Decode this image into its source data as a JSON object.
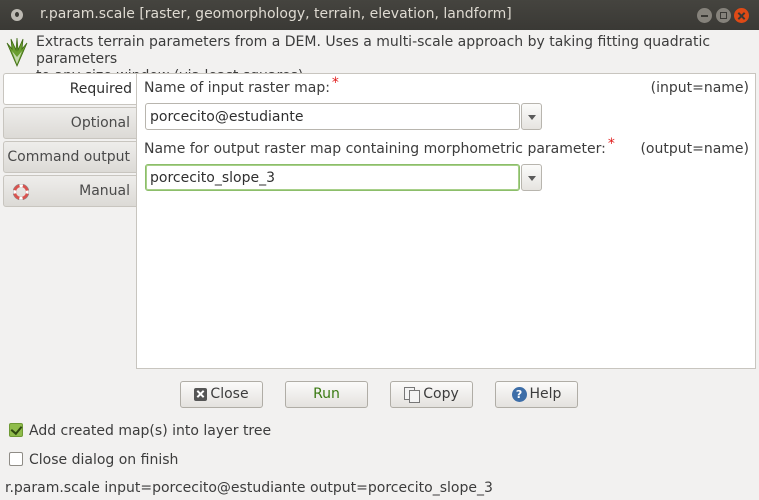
{
  "window": {
    "title": "r.param.scale [raster, geomorphology, terrain, elevation, landform]"
  },
  "description": "Extracts terrain parameters from a DEM. Uses a multi-scale approach by taking fitting quadratic parameters\nto any size window (via least squares).",
  "tabs": [
    {
      "label": "Required",
      "active": true
    },
    {
      "label": "Optional",
      "active": false
    },
    {
      "label": "Command output",
      "active": false
    },
    {
      "label": "Manual",
      "active": false
    }
  ],
  "fields": {
    "input": {
      "label": "Name of input raster map:",
      "required_mark": "*",
      "key": "(input=name)",
      "value": "porcecito@estudiante"
    },
    "output": {
      "label": "Name for output raster map containing morphometric parameter:",
      "required_mark": "*",
      "key": "(output=name)",
      "value": "porcecito_slope_3"
    }
  },
  "buttons": {
    "close": "Close",
    "run": "Run",
    "copy": "Copy",
    "help": "Help"
  },
  "options": {
    "add_to_tree": {
      "label": "Add created map(s) into layer tree",
      "checked": true
    },
    "close_on_finish": {
      "label": "Close dialog on finish",
      "checked": false
    }
  },
  "command_line": "r.param.scale input=porcecito@estudiante output=porcecito_slope_3",
  "colors": {
    "titlebar": "#3a3935",
    "close_button": "#df4a16",
    "run_text": "#3a7a12",
    "required_mark": "#e01b1b",
    "checkbox_checked": "#8fbc4b"
  }
}
